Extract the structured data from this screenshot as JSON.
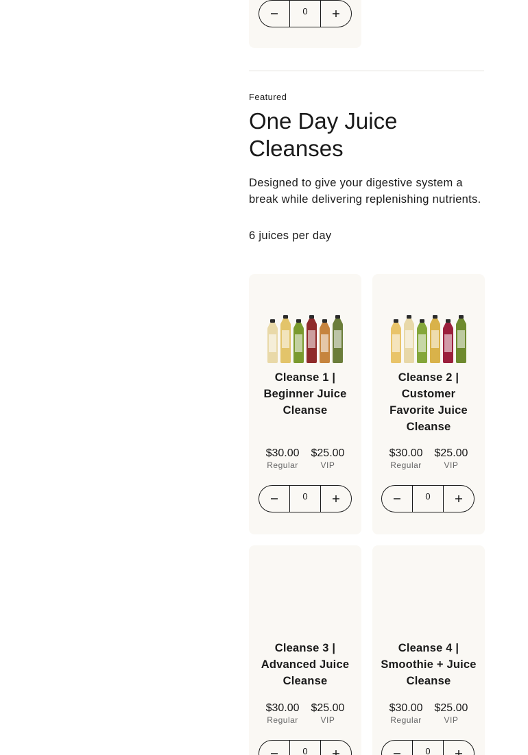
{
  "top_card": {
    "stepper": {
      "quantity": "0",
      "decrease_icon": "minus-icon",
      "increase_icon": "plus-icon"
    }
  },
  "section": {
    "eyebrow": "Featured",
    "title": "One Day Juice Cleanses",
    "description": "Designed to give your digestive system a break while delivering replenishing nutrients.",
    "per_day": "6 juices per day"
  },
  "products": [
    {
      "name": "Cleanse 1 | Beginner Juice Cleanse",
      "regular_price": "$30.00",
      "regular_label": "Regular",
      "vip_price": "$25.00",
      "vip_label": "VIP",
      "quantity": "0",
      "bottle_colors": [
        "#e9d9a8",
        "#e3c46a",
        "#7a9a2e",
        "#8f2a2a",
        "#c6843e",
        "#6b7d3a"
      ]
    },
    {
      "name": "Cleanse 2 | Customer Favorite Juice Cleanse",
      "regular_price": "$30.00",
      "regular_label": "Regular",
      "vip_price": "$25.00",
      "vip_label": "VIP",
      "quantity": "0",
      "bottle_colors": [
        "#e9c46a",
        "#e8d8a8",
        "#84a63a",
        "#d9b24a",
        "#9b1f3c",
        "#6e8a2e"
      ]
    },
    {
      "name": "Cleanse 3 | Advanced Juice Cleanse",
      "regular_price": "$30.00",
      "regular_label": "Regular",
      "vip_price": "$25.00",
      "vip_label": "VIP",
      "quantity": "0"
    },
    {
      "name": "Cleanse 4 | Smoothie + Juice Cleanse",
      "regular_price": "$30.00",
      "regular_label": "Regular",
      "vip_price": "$25.00",
      "vip_label": "VIP",
      "quantity": "0"
    }
  ],
  "colors": {
    "card_background": "#faf8f4",
    "text": "#1a1a1a",
    "divider": "#e4e1dc"
  }
}
